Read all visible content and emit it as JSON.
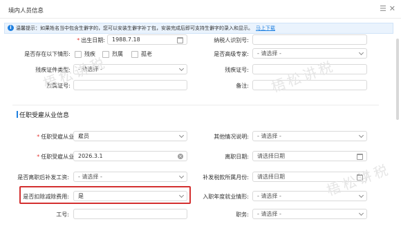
{
  "window": {
    "title": "境内人员信息"
  },
  "notice": {
    "text": "温馨提示：如果姓名当中包含生僻字的，您可以安装生僻字补丁包，安装完成后即可支持生僻字的录入和显示。",
    "link": "马上下载"
  },
  "form": {
    "birth_date": {
      "label": "出生日期:",
      "value": "1988.7.18"
    },
    "taxpayer_id": {
      "label": "纳税人识别号:",
      "value": ""
    },
    "special_situation": {
      "label": "是否存在以下情形:",
      "options": [
        "残疾",
        "烈属",
        "孤老"
      ]
    },
    "senior_expert": {
      "label": "是否高级专家:",
      "value": "- 请选择 -"
    },
    "disability_cert_type": {
      "label": "残疾证件类型:",
      "value": "- 请选择 -"
    },
    "disability_cert_no": {
      "label": "残疾证号:",
      "value": ""
    },
    "martyr_cert_no": {
      "label": "烈属证号:",
      "value": ""
    },
    "remarks": {
      "label": "备注:",
      "value": ""
    }
  },
  "employment": {
    "section_title": "任职受雇从业信息",
    "type": {
      "label": "任职受雇从业类型:",
      "value": "雇员"
    },
    "other_info": {
      "label": "其他情况说明:",
      "value": "- 请选择 -"
    },
    "date": {
      "label": "任职受雇从业日期:",
      "value": "2026.3.1"
    },
    "leave_date": {
      "label": "离职日期:",
      "placeholder": "请选择日期"
    },
    "pay_after_leave": {
      "label": "是否离职后补发工资:",
      "value": "- 请选择 -"
    },
    "supplement_month": {
      "label": "补发税款所属月份:",
      "placeholder": "请选择日期"
    },
    "deduct_expenses": {
      "label": "是否扣除减除费用:",
      "value": "是"
    },
    "entry_year_status": {
      "label": "入职年度就业情形:",
      "value": "- 请选择 -"
    },
    "employee_no": {
      "label": "工号:",
      "value": ""
    },
    "position": {
      "label": "职务:",
      "value": "- 请选择 -"
    }
  },
  "watermark": "梧松讲税",
  "accent_color": "#1d7fe0",
  "highlight_color": "#d32f2f"
}
